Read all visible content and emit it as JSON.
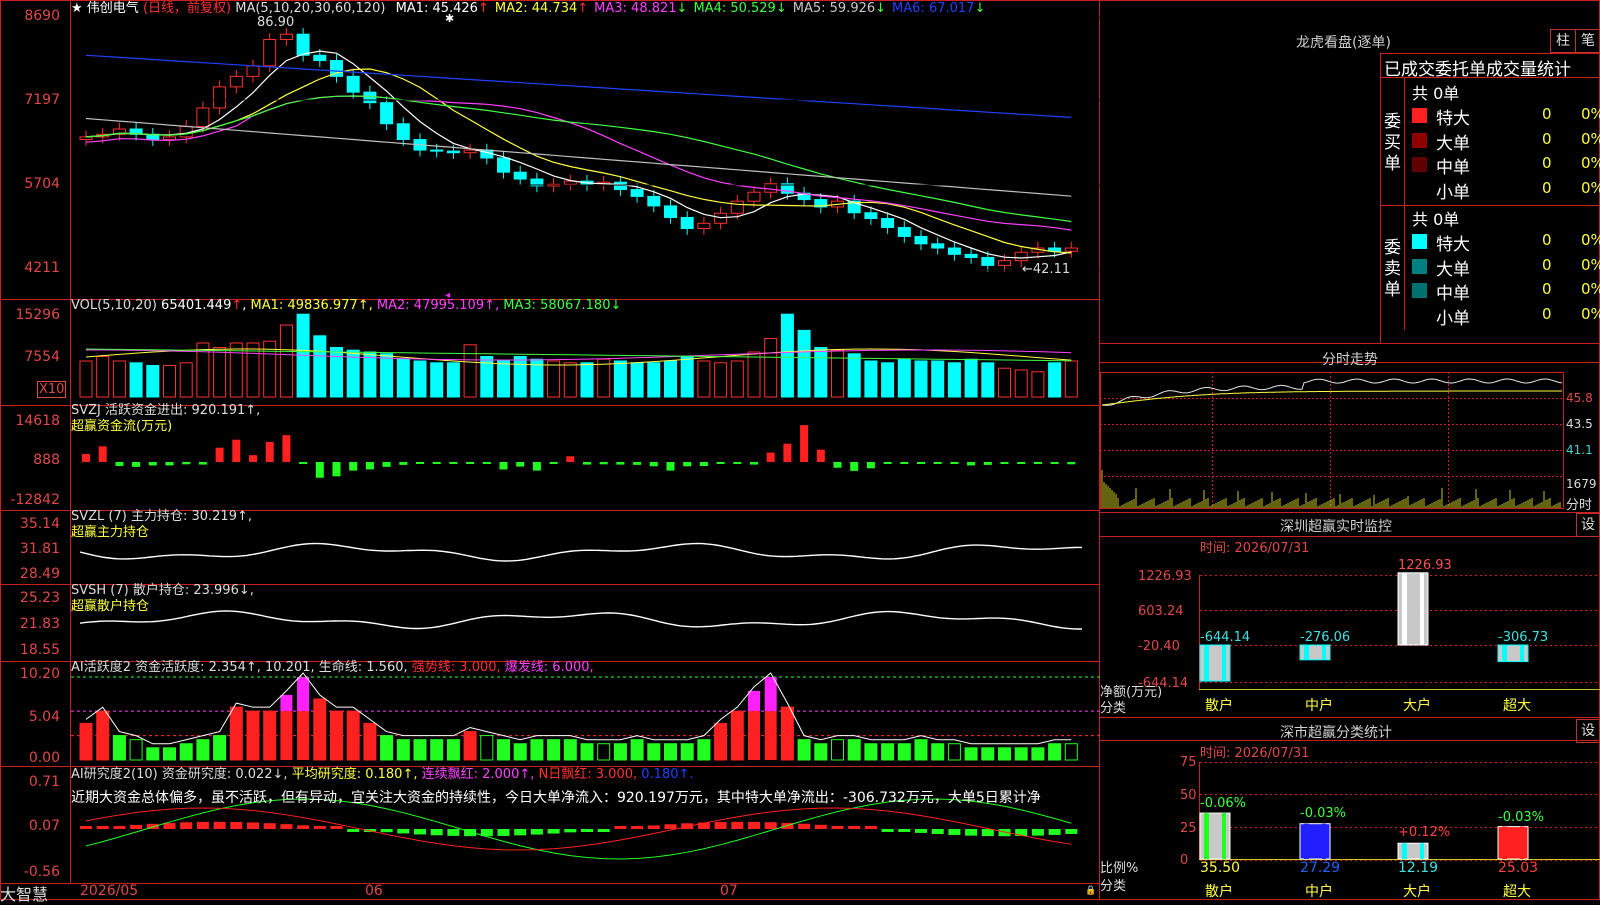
{
  "stock": {
    "name": "伟创电气",
    "mode": "(日线，前复权)",
    "star": "★"
  },
  "main_chart": {
    "ma_label": "MA(5,10,20,30,60,120)",
    "ma": [
      {
        "label": "MA1:",
        "value": "45.426",
        "arrow": "↑",
        "color": "#ffffff"
      },
      {
        "label": "MA2:",
        "value": "44.734",
        "arrow": "↑",
        "color": "#ffff40"
      },
      {
        "label": "MA3:",
        "value": "48.821",
        "arrow": "↓",
        "color": "#ff40ff"
      },
      {
        "label": "MA4:",
        "value": "50.529",
        "arrow": "↓",
        "color": "#40ff40"
      },
      {
        "label": "MA5:",
        "value": "59.926",
        "arrow": "↓",
        "color": "#c8c8c8"
      },
      {
        "label": "MA6:",
        "value": "67.017",
        "arrow": "↓",
        "color": "#2040ff"
      }
    ],
    "y_ticks": [
      "8690",
      "7197",
      "5704",
      "4211"
    ],
    "high_label": "86.90",
    "low_label": "←42.11"
  },
  "vol": {
    "header": "VOL(5,10,20)",
    "value": "65401.449",
    "arrow": "↑",
    "ma1": "MA1: 49836.977↑,",
    "ma2": "MA2: 47995.109↑,",
    "ma3": "MA3: 58067.180↓",
    "y_ticks": [
      "15296",
      "7554"
    ],
    "unit": "X10"
  },
  "svzj": {
    "header": "SVZJ  活跃资金进出: 920.191↑,",
    "sub": "超赢资金流(万元)",
    "y_ticks": [
      "14618",
      "888",
      "-12842"
    ]
  },
  "svzl": {
    "header": "SVZL (7) 主力持仓: 30.219↑,",
    "sub": "超赢主力持仓",
    "y_ticks": [
      "35.14",
      "31.81",
      "28.49"
    ]
  },
  "svsh": {
    "header": "SVSH (7) 散户持仓: 23.996↓,",
    "sub": "超赢散户持仓",
    "y_ticks": [
      "25.23",
      "21.83",
      "18.55"
    ]
  },
  "ai_active": {
    "header": "AI活跃度2 资金活跃度: 2.354↑, 10.201, 生命线: 1.560,",
    "strong": "强势线: 3.000,",
    "burst": "爆发线: 6.000,",
    "y_ticks": [
      "10.20",
      "5.04",
      "0.00"
    ]
  },
  "ai_research": {
    "header1": "AI研究度2(10) 资金研究度: 0.022↓,",
    "avg": "平均研究度: 0.180↑,",
    "cont": "连续飘红: 2.000↑,",
    "nday": "N日飘红: 3.000,",
    "tail": "0.180↑.",
    "y_ticks": [
      "0.71",
      "0.07",
      "-0.56"
    ],
    "comment": "近期大资金总体偏多，虽不活跃，但有异动，宜关注大资金的持续性，今日大单净流入：920.197万元，其中特大单净流出：-306.732万元，大单5日累计净"
  },
  "x_axis": {
    "labels": [
      "2026/05",
      "06",
      "07"
    ],
    "brand": "大智慧"
  },
  "right": {
    "lhb": {
      "title": "龙虎看盘(逐单)",
      "btn1": "柱",
      "btn2": "笔",
      "tabs": [
        "已成交",
        "委托单",
        "成交量统计"
      ],
      "buy": {
        "side": "委买单",
        "total": "共 0单",
        "rows": [
          {
            "label": "特大",
            "v": "0",
            "p": "0%",
            "c": "#ff2020"
          },
          {
            "label": "大单",
            "v": "0",
            "p": "0%",
            "c": "#900000"
          },
          {
            "label": "中单",
            "v": "0",
            "p": "0%",
            "c": "#600000"
          },
          {
            "label": "小单",
            "v": "0",
            "p": "0%",
            "c": "#000000"
          }
        ]
      },
      "sell": {
        "side": "委卖单",
        "total": "共 0单",
        "rows": [
          {
            "label": "特大",
            "v": "0",
            "p": "0%",
            "c": "#00ffff"
          },
          {
            "label": "大单",
            "v": "0",
            "p": "0%",
            "c": "#008080"
          },
          {
            "label": "中单",
            "v": "0",
            "p": "0%",
            "c": "#007070"
          },
          {
            "label": "小单",
            "v": "0",
            "p": "0%",
            "c": "#000000"
          }
        ]
      }
    },
    "fenshi": {
      "title": "分时走势",
      "ticks": [
        "45.8",
        "43.5",
        "41.1",
        "1679",
        "分时"
      ]
    },
    "sz_monitor": {
      "title": "深圳超赢实时监控",
      "btn": "设",
      "time": "时间: 2026/07/31",
      "y_ticks": [
        "1226.93",
        "603.24",
        "-20.40",
        "-644.14"
      ],
      "ylabel": "净额(万元)",
      "xlabel": "分类",
      "categories": [
        "散户",
        "中户",
        "大户",
        "超大"
      ],
      "values": [
        -644.14,
        -276.06,
        1226.93,
        -306.73
      ],
      "value_labels": [
        "-644.14",
        "-276.06",
        "1226.93",
        "-306.73"
      ]
    },
    "sz_class": {
      "title": "深市超赢分类统计",
      "btn": "设",
      "time": "时间: 2026/07/31",
      "y_ticks": [
        "75",
        "50",
        "25",
        "0"
      ],
      "ylabel": "比例%",
      "xlabel": "分类",
      "categories": [
        "散户",
        "中户",
        "大户",
        "超大"
      ],
      "values": [
        35.5,
        27.29,
        12.19,
        25.03
      ],
      "changes": [
        "-0.06%",
        "-0.03%",
        "+0.12%",
        "-0.03%"
      ],
      "value_labels": [
        "35.50",
        "27.29",
        "12.19",
        "25.03"
      ]
    }
  },
  "chart_data": [
    {
      "type": "candlestick",
      "title": "伟创电气 (日线，前复权)",
      "ylim": [
        42,
        90
      ],
      "series": [
        {
          "name": "price_close_approx",
          "values": [
            66.5,
            67,
            68,
            67,
            66,
            66.5,
            68.5,
            72,
            76,
            78,
            80,
            85,
            86,
            82,
            81,
            78,
            75,
            73,
            69,
            66,
            64,
            63.8,
            63.5,
            64,
            62.5,
            59.8,
            58.5,
            57.2,
            57.5,
            58.1,
            57.4,
            57.9,
            56.5,
            55.2,
            53.4,
            51.2,
            49.1,
            50.1,
            52,
            54.3,
            56,
            57.6,
            55.8,
            54.6,
            53.2,
            54.3,
            52.1,
            51,
            49.3,
            47.6,
            46.2,
            45.4,
            44.2,
            43.6,
            42.1,
            43,
            44.6,
            45.4,
            44.8,
            45.4
          ]
        }
      ]
    },
    {
      "type": "bar",
      "title": "超赢资金流(万元)",
      "values": [
        2800,
        5500,
        -1400,
        -1700,
        -1200,
        -1200,
        -800,
        -900,
        5000,
        7800,
        2400,
        7000,
        9400,
        -300,
        -5500,
        -5000,
        -3000,
        -2600,
        -1700,
        -1000,
        -300,
        -300,
        -300,
        -300,
        -600,
        -2600,
        -1600,
        -3000,
        -300,
        2000,
        -900,
        -800,
        -900,
        -1000,
        -1500,
        -3000,
        -1500,
        -1400,
        -400,
        -600,
        -900,
        3300,
        6400,
        12900,
        4300,
        -2000,
        -3100,
        -2200,
        -300,
        -300,
        -300,
        -300,
        -300,
        -1200,
        -1000,
        -300,
        -300,
        -300,
        -300,
        -800
      ]
    },
    {
      "type": "bar",
      "title": "AI活跃度2",
      "values": [
        4.5,
        6.0,
        3.0,
        2.5,
        1.5,
        1.5,
        2.0,
        2.5,
        3.0,
        6.5,
        6.0,
        6.0,
        8.0,
        10.2,
        7.5,
        6.0,
        6.0,
        4.5,
        3.0,
        2.5,
        2.5,
        2.5,
        2.5,
        3.5,
        3.0,
        2.5,
        2.0,
        2.5,
        2.5,
        2.5,
        2.0,
        2.0,
        2.0,
        2.5,
        2.0,
        2.0,
        2.0,
        2.5,
        4.5,
        6.0,
        8.5,
        10.2,
        6.5,
        2.5,
        2.0,
        2.5,
        2.5,
        2.0,
        2.0,
        2.0,
        2.5,
        2.0,
        2.0,
        1.5,
        1.5,
        1.5,
        1.5,
        1.5,
        2.0,
        2.0
      ]
    }
  ]
}
